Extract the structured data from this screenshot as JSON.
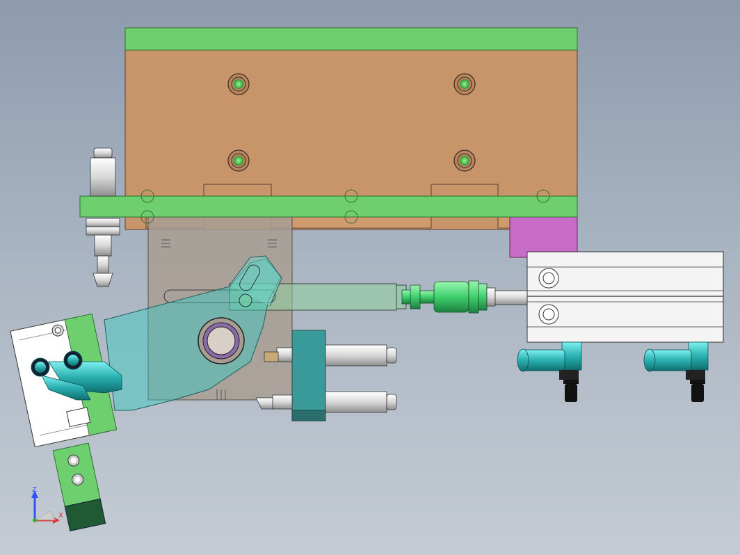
{
  "viewport": {
    "background_top": "#8e9bad",
    "background_bottom": "#c4cbd3"
  },
  "colors": {
    "plate_green": "#6ecf6e",
    "mount_brown": "#c8946a",
    "block_magenta": "#c86cc8",
    "fitting_teal": "#3fb8b8",
    "slider_green": "#4fd67a",
    "arm_teal_transparent": "#33c9c0",
    "body_gray": "#a89d93"
  },
  "triad": {
    "z_label": "Z",
    "x_label": "X",
    "z_color": "#3050ff",
    "x_color": "#e03030",
    "origin_color": "#30b030"
  }
}
